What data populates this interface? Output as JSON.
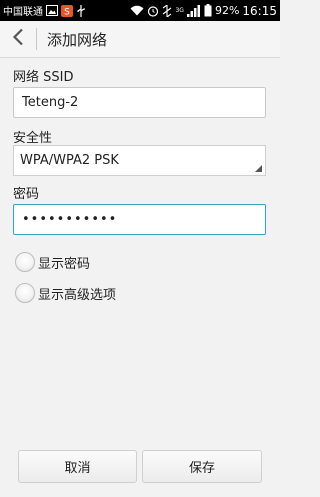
{
  "status_bar": {
    "carrier": "中国联通",
    "network_tag": "3G",
    "battery": "92%",
    "time": "16:15"
  },
  "header": {
    "title": "添加网络"
  },
  "form": {
    "ssid_label": "网络 SSID",
    "ssid_value": "Teteng-2",
    "security_label": "安全性",
    "security_value": "WPA/WPA2 PSK",
    "password_label": "密码",
    "password_value": "•••••••••••",
    "show_password_label": "显示密码",
    "show_password_checked": false,
    "show_advanced_label": "显示高级选项",
    "show_advanced_checked": false
  },
  "buttons": {
    "cancel": "取消",
    "save": "保存"
  }
}
